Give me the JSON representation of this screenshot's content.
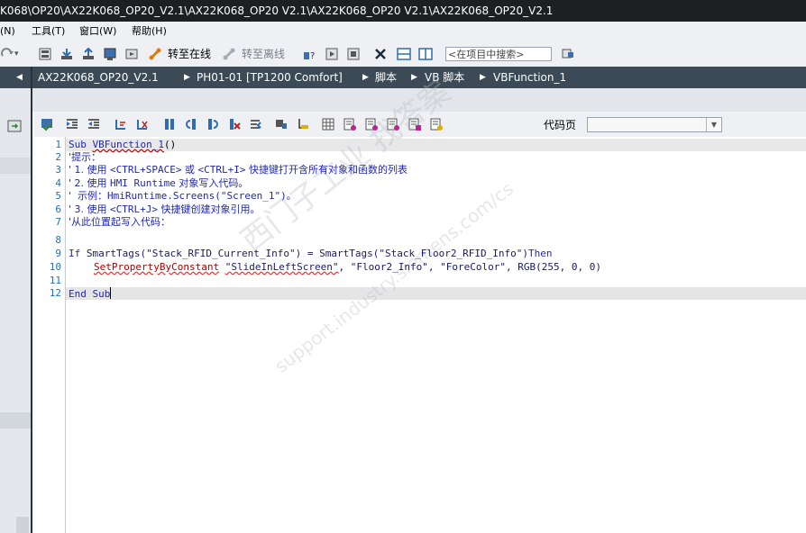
{
  "window": {
    "title": "K068\\OP20\\AX22K068_OP20_V2.1\\AX22K068_OP20 V2.1\\AX22K068_OP20 V2.1\\AX22K068_OP20_V2.1"
  },
  "menu": {
    "items": [
      "(N)",
      "工具(T)",
      "窗口(W)",
      "帮助(H)"
    ]
  },
  "toolbar": {
    "go_online": "转至在线",
    "go_offline": "转至离线",
    "search_placeholder": "<在项目中搜索>"
  },
  "breadcrumb": [
    "AX22K068_OP20_V2.1",
    "PH01-01 [TP1200 Comfort]",
    "脚本",
    "VB 脚本",
    "VBFunction_1"
  ],
  "editor_toolbar": {
    "code_page_label": "代码页",
    "code_page_value": ""
  },
  "code": {
    "line_numbers": [
      "1",
      "2",
      "3",
      "4",
      "5",
      "6",
      "7",
      "8",
      "9",
      "10",
      "11",
      "12"
    ],
    "line1_kw": "Sub ",
    "line1_name": "VBFunction_1",
    "line1_rest": "()",
    "line2": "'提示：",
    "line3_a": "' 1. 使用 ",
    "line3_b": "<CTRL+SPACE>",
    "line3_c": " 或 ",
    "line3_d": "<CTRL+I>",
    "line3_e": " 快捷键打开含所有对象和函数的列表",
    "line4_a": "' 2. 使用 ",
    "line4_b": "HMI Runtime",
    "line4_c": " 对象写入代码。",
    "line5_a": "'  示例：",
    "line5_b": "HmiRuntime.Screens(\"Screen_1\")",
    "line5_c": "。",
    "line6_a": "' 3. 使用 ",
    "line6_b": "<CTRL+J>",
    "line6_c": " 快捷键创建对象引用。",
    "line7": "'从此位置起写入代码：",
    "line9_if": "If ",
    "line9_a": "SmartTags(\"Stack_RFID_Current_Info\") = SmartTags(\"Stack_Floor2_RFID_Info\")",
    "line9_then": "Then",
    "line10_a": "SetPropertyByConstant",
    "line10_b": " ",
    "line10_c": "\"SlideInLeftScreen\"",
    "line10_d": ", \"Floor2_Info\", \"ForeColor\", RGB(255, 0, 0)",
    "line12": "End Sub"
  },
  "watermark": {
    "line1": "西门子工业  找答案",
    "line2": "support.industry.siemens.com/cs"
  },
  "colors": {
    "title_bg": "#1e1f22",
    "breadcrumb_bg": "#3b4a56",
    "keyword": "#1f28b4",
    "current_line": "#e5e5e5"
  }
}
